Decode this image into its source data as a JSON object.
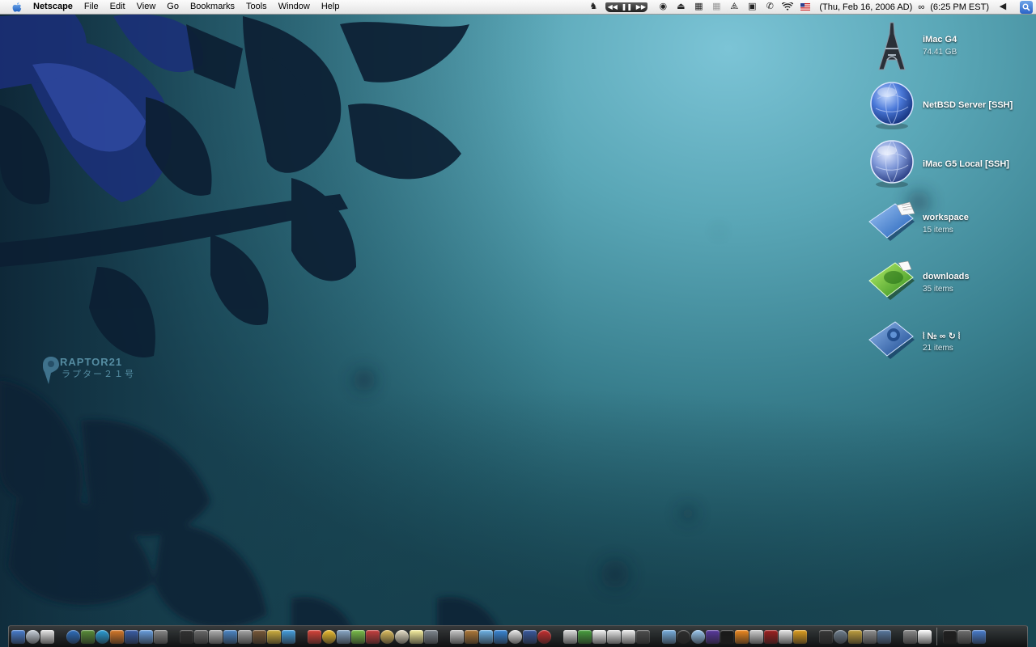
{
  "menubar": {
    "app_name": "Netscape",
    "menus": [
      "File",
      "Edit",
      "View",
      "Go",
      "Bookmarks",
      "Tools",
      "Window",
      "Help"
    ],
    "clock": {
      "date": "(Thu, Feb 16, 2006 AD)",
      "separator": "∞",
      "time": "(6:25 PM EST)"
    },
    "status_icons": [
      "chess-knight-icon",
      "itunes-controls-icon",
      "palette-icon",
      "eject-icon",
      "binoculars-icon",
      "menu-meter-icon",
      "script-icon",
      "chat-icon",
      "phone-icon",
      "wifi-icon",
      "us-flag-icon",
      "volume-icon",
      "spotlight-icon"
    ]
  },
  "watermark": {
    "line1": "RAPTOR21",
    "line2": "ラプター２１号"
  },
  "desktop_icons": [
    {
      "name": "iMac G4",
      "detail": "74.41 GB",
      "icon": "eiffel-tower-drive-icon"
    },
    {
      "name": "NetBSD Server [SSH]",
      "detail": "",
      "icon": "network-globe-icon"
    },
    {
      "name": "iMac G5 Local [SSH]",
      "detail": "",
      "icon": "network-globe-icon"
    },
    {
      "name": "workspace",
      "detail": "15 items",
      "icon": "blue-folder-icon"
    },
    {
      "name": "downloads",
      "detail": "35 items",
      "icon": "green-folder-icon"
    },
    {
      "name": "⦚ № ∞ ↻ ⦚",
      "detail": "21 items",
      "icon": "blue-folder-icon"
    }
  ],
  "dock": {
    "items": [
      "finder-icon",
      "dashboard-icon",
      "spotlight-dock-icon",
      "sep",
      "safari-icon",
      "mail-icon",
      "globe-icon",
      "firefox-icon",
      "camino-icon",
      "itunes-icon",
      "address-book-icon",
      "sep",
      "terminal-icon",
      "console-icon",
      "activity-monitor-icon",
      "disk-utility-icon",
      "network-utility-icon",
      "script-editor-icon",
      "keychain-icon",
      "ichat-icon",
      "sep",
      "photoshop-icon",
      "sun-icon",
      "preview-icon",
      "iphoto-icon",
      "flag-app-icon",
      "coin-icon",
      "clock-icon",
      "textedit-icon",
      "stickies-icon",
      "sep2",
      "graph-icon",
      "bird-icon",
      "tool-icon",
      "fish-icon",
      "globe2-icon",
      "pages-icon",
      "quicktime-icon",
      "sep",
      "acrobat-icon",
      "calculator-icon",
      "money-icon",
      "docs-icon",
      "notes-icon",
      "paper-icon",
      "sep",
      "audio-hijack-icon",
      "cd-icon",
      "dvd-icon",
      "itunes2-icon",
      "nowplaying-icon",
      "speaker-icon",
      "vlc-icon",
      "radio-icon",
      "burn-icon",
      "ipod-icon",
      "sep",
      "trophy-icon",
      "dashboard2-icon",
      "xcode-icon",
      "hammer-icon",
      "wrench-icon",
      "sep",
      "system-prefs-icon",
      "utilities-icon",
      "sep-line",
      "signature-icon",
      "minimized-window-icon",
      "trash-icon"
    ]
  },
  "colors": {
    "wallpaper_light": "#7cc4d6",
    "wallpaper_dark": "#1a4a56",
    "foliage": "#0e2338",
    "menubar": "#ececec"
  }
}
